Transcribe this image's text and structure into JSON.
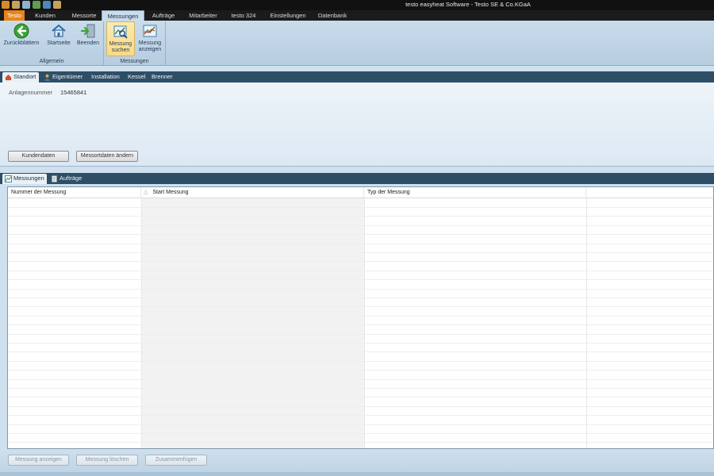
{
  "window": {
    "title": "testo easyheat Software - Testo SE & Co.KGaA"
  },
  "ribbon_tabs": [
    {
      "label": "Testo"
    },
    {
      "label": "Kunden"
    },
    {
      "label": "Messorte"
    },
    {
      "label": "Messungen"
    },
    {
      "label": "Aufträge"
    },
    {
      "label": "Mitarbeiter"
    },
    {
      "label": "testo 324"
    },
    {
      "label": "Einstellungen"
    },
    {
      "label": "Datenbank"
    }
  ],
  "ribbon": {
    "groups": {
      "allgemein": "Allgemein",
      "messungen": "Messungen"
    },
    "buttons": {
      "back": "Zurückblättern",
      "home": "Startseite",
      "exit": "Beenden",
      "search_line1": "Messung",
      "search_line2": "suchen",
      "show_line1": "Messung",
      "show_line2": "anzeigen"
    }
  },
  "upper_tabs": [
    {
      "label": "Standort"
    },
    {
      "label": "Eigentümer"
    },
    {
      "label": "Installation"
    },
    {
      "label": "Kessel"
    },
    {
      "label": "Brenner"
    }
  ],
  "site": {
    "label": "Anlagennummer",
    "value": "15465841",
    "btn_customer": "Kundendaten",
    "btn_edit": "Messortdaten ändern"
  },
  "lower_tabs": [
    {
      "label": "Messungen"
    },
    {
      "label": "Aufträge"
    }
  ],
  "grid": {
    "columns": [
      "Nummer der Messung",
      "Start Messung",
      "Typ der Messung"
    ],
    "sort_indicator": "△"
  },
  "bottom_buttons": {
    "show": "Messung anzeigen",
    "delete": "Messung löschen",
    "merge": "Zusammenfügen"
  },
  "colors": {
    "accent": "#e8831c",
    "panel_header": "#2e4e66",
    "ribbon": "#c9dceb"
  }
}
